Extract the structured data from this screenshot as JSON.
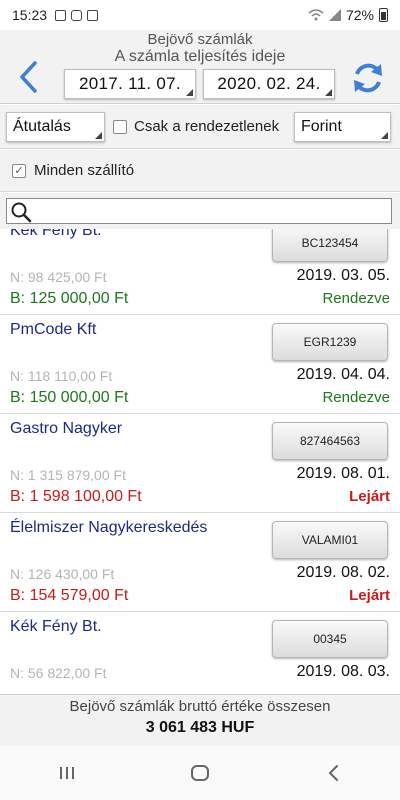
{
  "status_bar": {
    "time": "15:23",
    "battery": "72%",
    "icons": [
      "photo-icon",
      "message-icon",
      "check-icon",
      "wifi-icon",
      "signal-icon",
      "battery-icon"
    ]
  },
  "header": {
    "title": "Bejövő számlák",
    "subtitle": "A számla teljesítés ideje",
    "date_from": "2017. 11. 07.",
    "date_to": "2020. 02. 24.",
    "back_icon": "chevron-left-icon",
    "refresh_icon": "refresh-icon",
    "accent_color": "#3f7fd6"
  },
  "filters": {
    "payment_method": "Átutalás",
    "only_unsettled_label": "Csak a rendezetlenek",
    "only_unsettled_checked": false,
    "currency": "Forint",
    "all_suppliers_label": "Minden szállító",
    "all_suppliers_checked": true
  },
  "search": {
    "value": "",
    "icon": "search-icon"
  },
  "invoices": [
    {
      "supplier": "Kék Fény Bt.",
      "code": "BC123454",
      "net": "N: 98 425,00 Ft",
      "gross": "B: 125 000,00 Ft",
      "date": "2019. 03. 05.",
      "status": "Rendezve",
      "status_type": "ok"
    },
    {
      "supplier": "PmCode Kft",
      "code": "EGR1239",
      "net": "N: 118 110,00 Ft",
      "gross": "B: 150 000,00 Ft",
      "date": "2019. 04. 04.",
      "status": "Rendezve",
      "status_type": "ok"
    },
    {
      "supplier": "Gastro Nagyker",
      "code": "827464563",
      "net": "N: 1 315 879,00 Ft",
      "gross": "B: 1 598 100,00 Ft",
      "date": "2019. 08. 01.",
      "status": "Lejárt",
      "status_type": "bad"
    },
    {
      "supplier": "Élelmiszer Nagykereskedés",
      "code": "VALAMI01",
      "net": "N: 126 430,00 Ft",
      "gross": "B: 154 579,00 Ft",
      "date": "2019. 08. 02.",
      "status": "Lejárt",
      "status_type": "bad"
    },
    {
      "supplier": "Kék Fény Bt.",
      "code": "00345",
      "net": "N: 56 822,00 Ft",
      "gross": "",
      "date": "2019. 08. 03.",
      "status": "",
      "status_type": "ok"
    }
  ],
  "footer": {
    "label": "Bejövő számlák bruttó értéke összesen",
    "total": "3 061 483 HUF"
  },
  "nav": {
    "icons": [
      "recent-apps-icon",
      "home-icon",
      "back-icon"
    ]
  },
  "colors": {
    "supplier_name": "#1b2a8a",
    "settled": "#1b7a1b",
    "overdue": "#c81b1b",
    "net_amount": "#b5b5b5"
  }
}
